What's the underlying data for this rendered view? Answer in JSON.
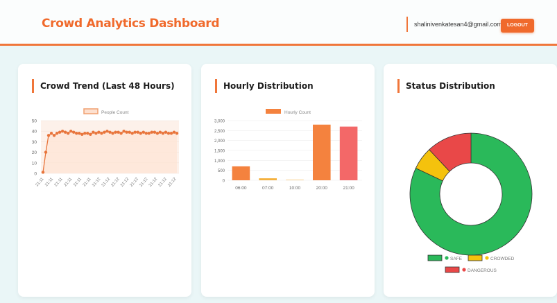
{
  "header": {
    "title": "Crowd Analytics Dashboard",
    "user_email": "shalinivenkatesan4@gmail.com",
    "logout_label": "LOGOUT"
  },
  "colors": {
    "accent": "#f0763a",
    "safe": "#2ab95a",
    "crowded": "#f4c20d",
    "dangerous": "#e94848"
  },
  "cards": {
    "trend_title": "Crowd Trend (Last 48 Hours)",
    "hourly_title": "Hourly Distribution",
    "status_title": "Status Distribution"
  },
  "chart_data": [
    {
      "type": "line",
      "legend": "People Count",
      "ylim": [
        0,
        50
      ],
      "yticks": [
        "0",
        "10",
        "20",
        "30",
        "40",
        "50"
      ],
      "x_labels": [
        "21:11",
        "21:11",
        "21:11",
        "21:11",
        "21:11",
        "21:11",
        "21:12",
        "21:12",
        "21:12",
        "21:12",
        "21:12",
        "21:12",
        "21:12",
        "21:12",
        "21:12"
      ],
      "values": [
        1,
        20,
        36,
        38,
        36,
        38,
        39,
        40,
        39,
        38,
        40,
        39,
        38,
        38,
        37,
        38,
        38,
        37,
        39,
        38,
        39,
        38,
        39,
        40,
        39,
        38,
        39,
        39,
        38,
        40,
        39,
        39,
        38,
        39,
        39,
        38,
        39,
        38,
        38,
        39,
        39,
        38,
        39,
        38,
        39,
        38,
        38,
        39,
        38
      ]
    },
    {
      "type": "bar",
      "legend": "Hourly Count",
      "ylim": [
        0,
        3000
      ],
      "yticks": [
        "0",
        "500",
        "1,000",
        "1,500",
        "2,000",
        "2,500",
        "3,000"
      ],
      "categories": [
        "06:00",
        "07:00",
        "10:00",
        "20:00",
        "21:00"
      ],
      "values": [
        700,
        100,
        20,
        2800,
        2700
      ],
      "colors": [
        "#f4823e",
        "#f4b13e",
        "#f4b13e",
        "#f4823e",
        "#f36868"
      ]
    },
    {
      "type": "pie",
      "labels": [
        "SAFE",
        "CROWDED",
        "DANGEROUS"
      ],
      "values": [
        82,
        6,
        12
      ],
      "colors": [
        "#2ab95a",
        "#f4c20d",
        "#e94848"
      ]
    }
  ]
}
